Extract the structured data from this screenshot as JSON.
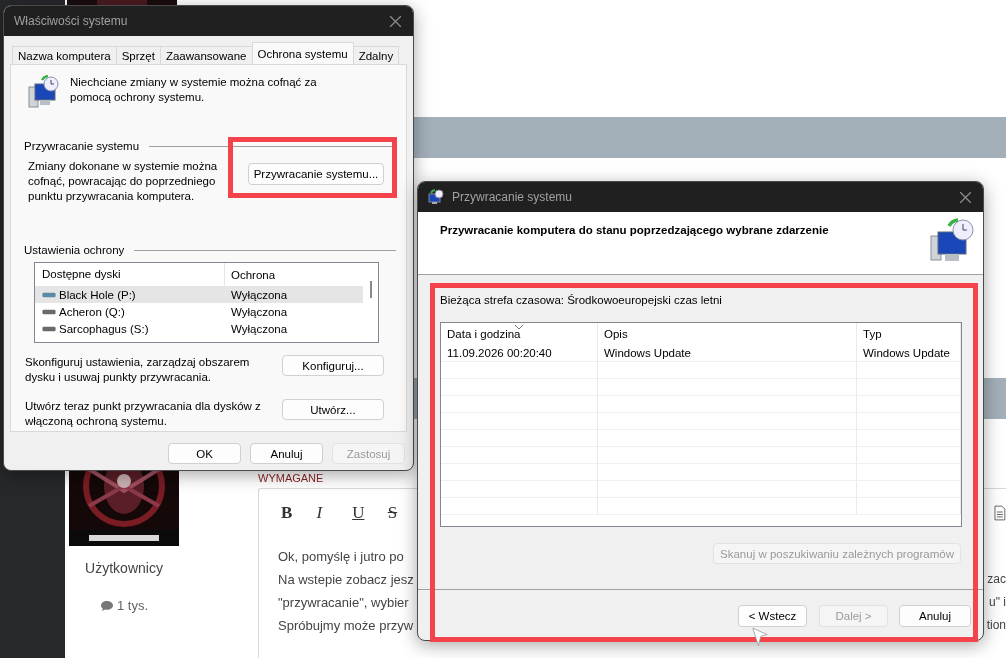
{
  "background_page": {
    "required_label": "WYMAGANE",
    "author": {
      "role": "Użytkownicy",
      "posts": "1 tys."
    },
    "editor": {
      "toolbar": [
        {
          "kind": "bold",
          "label": "B"
        },
        {
          "kind": "italic",
          "label": "I"
        },
        {
          "kind": "underline",
          "label": "U"
        },
        {
          "kind": "strike",
          "label": "S"
        }
      ],
      "lines": [
        {
          "left": "Ok, pomyślę i jutro po"
        },
        {
          "left": "Na wstepie zobacz jesz",
          "right": "zac"
        },
        {
          "left": "\"przywracanie\", wybier",
          "right": "u\" i"
        },
        {
          "left": "Spróbujmy może przyw",
          "right": "tion"
        }
      ]
    }
  },
  "system_properties": {
    "title": "Właściwości systemu",
    "tabs": [
      {
        "label": "Nazwa komputera",
        "selected": false
      },
      {
        "label": "Sprzęt",
        "selected": false
      },
      {
        "label": "Zaawansowane",
        "selected": false
      },
      {
        "label": "Ochrona systemu",
        "selected": true
      },
      {
        "label": "Zdalny",
        "selected": false
      }
    ],
    "intro": "Niechciane zmiany w systemie można cofnąć za pomocą ochrony systemu.",
    "restore_group": {
      "heading": "Przywracanie systemu",
      "text": "Zmiany dokonane w systemie można cofnąć, powracając do poprzedniego punktu przywracania komputera.",
      "button": "Przywracanie systemu..."
    },
    "protection_group": {
      "heading": "Ustawienia ochrony",
      "columns": [
        "Dostępne dyski",
        "Ochrona"
      ],
      "drives": [
        {
          "name": "Black Hole (P:)",
          "protection": "Wyłączona",
          "selected": true
        },
        {
          "name": "Acheron (Q:)",
          "protection": "Wyłączona",
          "selected": false
        },
        {
          "name": "Sarcophagus (S:)",
          "protection": "Wyłączona",
          "selected": false
        }
      ],
      "configure_text": "Skonfiguruj ustawienia, zarządzaj obszarem dysku i usuwaj punkty przywracania.",
      "configure_button": "Konfiguruj...",
      "create_text": "Utwórz teraz punkt przywracania dla dysków z włączoną ochroną systemu.",
      "create_button": "Utwórz..."
    },
    "buttons": [
      {
        "label": "OK",
        "disabled": false
      },
      {
        "label": "Anuluj",
        "disabled": false
      },
      {
        "label": "Zastosuj",
        "disabled": true
      }
    ]
  },
  "restore_dialog": {
    "title": "Przywracanie systemu",
    "heading": "Przywracanie komputera do stanu poprzedzającego wybrane zdarzenie",
    "timezone": "Bieżąca strefa czasowa: Środkowoeuropejski czas letni",
    "table": {
      "columns": [
        "Data i godzina",
        "Opis",
        "Typ"
      ],
      "rows": [
        [
          "11.09.2026 00:20:40",
          "Windows Update",
          "Windows Update"
        ]
      ]
    },
    "scan_button": {
      "label": "Skanuj w poszukiwaniu zależnych programów",
      "disabled": true
    },
    "buttons": [
      {
        "label": "< Wstecz",
        "disabled": false
      },
      {
        "label": "Dalej >",
        "disabled": true
      },
      {
        "label": "Anuluj",
        "disabled": false
      }
    ]
  }
}
